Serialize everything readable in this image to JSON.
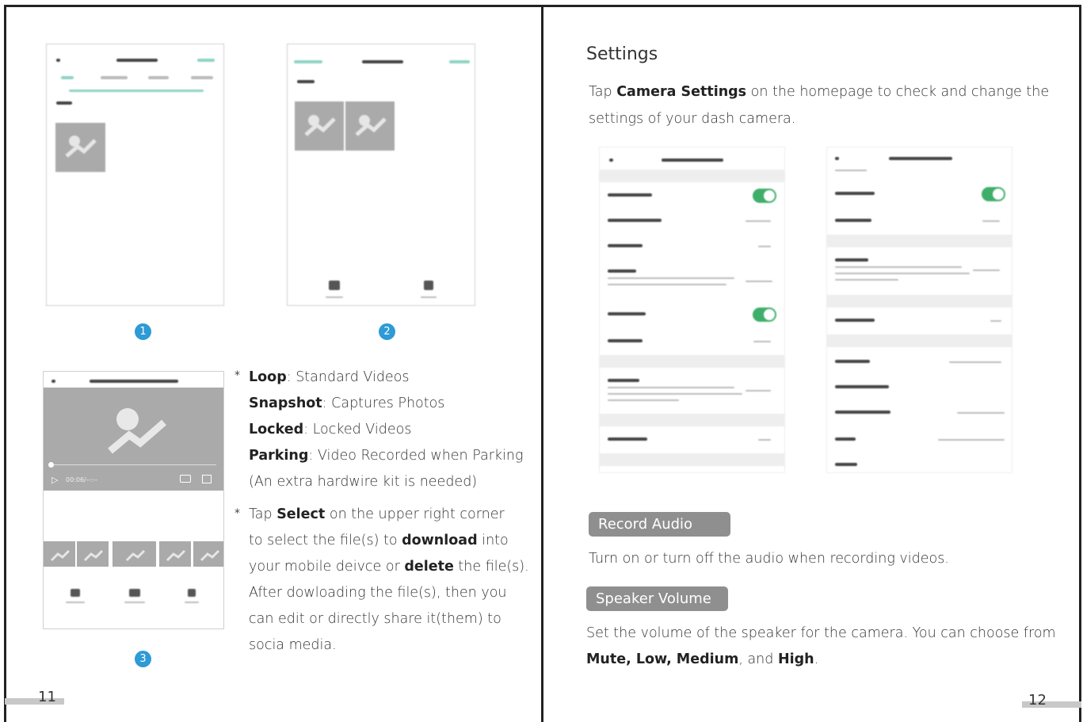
{
  "left_page": {
    "steps": [
      "1",
      "2",
      "3"
    ],
    "bullet_star": "*",
    "modes": [
      {
        "term": "Loop",
        "desc": ": Standard Videos"
      },
      {
        "term": "Snapshot",
        "desc": ": Captures Photos"
      },
      {
        "term": "Locked",
        "desc": ": Locked Videos"
      },
      {
        "term": "Parking",
        "desc": ": Video Recorded when Parking"
      }
    ],
    "parking_note": "(An extra hardwire kit is needed)",
    "select_text": {
      "t1": "Tap ",
      "b1": "Select",
      "t2": " on the upper right corner",
      "t3": "to select the file(s) to ",
      "b2": "download",
      "t4": " into",
      "t5": "your mobile deivce or ",
      "b3": "delete",
      "t6": " the file(s).",
      "t7": "After dowloading the file(s), then you",
      "t8": "can edit or directly share it(them) to",
      "t9": "socia media."
    },
    "player_time": "00:06/--:--",
    "page_number": "11"
  },
  "right_page": {
    "title": "Settings",
    "intro": {
      "t1": "Tap ",
      "b1": "Camera Settings",
      "t2": " on the homepage to check and change the",
      "t3": "settings of your dash camera."
    },
    "record_audio": {
      "label": "Record Audio",
      "desc": "Turn on or turn off the audio when recording videos."
    },
    "speaker_volume": {
      "label": "Speaker Volume",
      "desc": "Set the volume of the speaker for the camera. You can choose from",
      "opt1": "Mute, Low, Medium",
      "sep": ", and ",
      "opt2": "High",
      "end": "."
    },
    "page_number": "12"
  },
  "colors": {
    "step_circle": "#2e9ad6",
    "pill_bg": "#8f8f8f",
    "toggle_on": "#3fae6a",
    "thumb_gray": "#aaaaaa"
  }
}
